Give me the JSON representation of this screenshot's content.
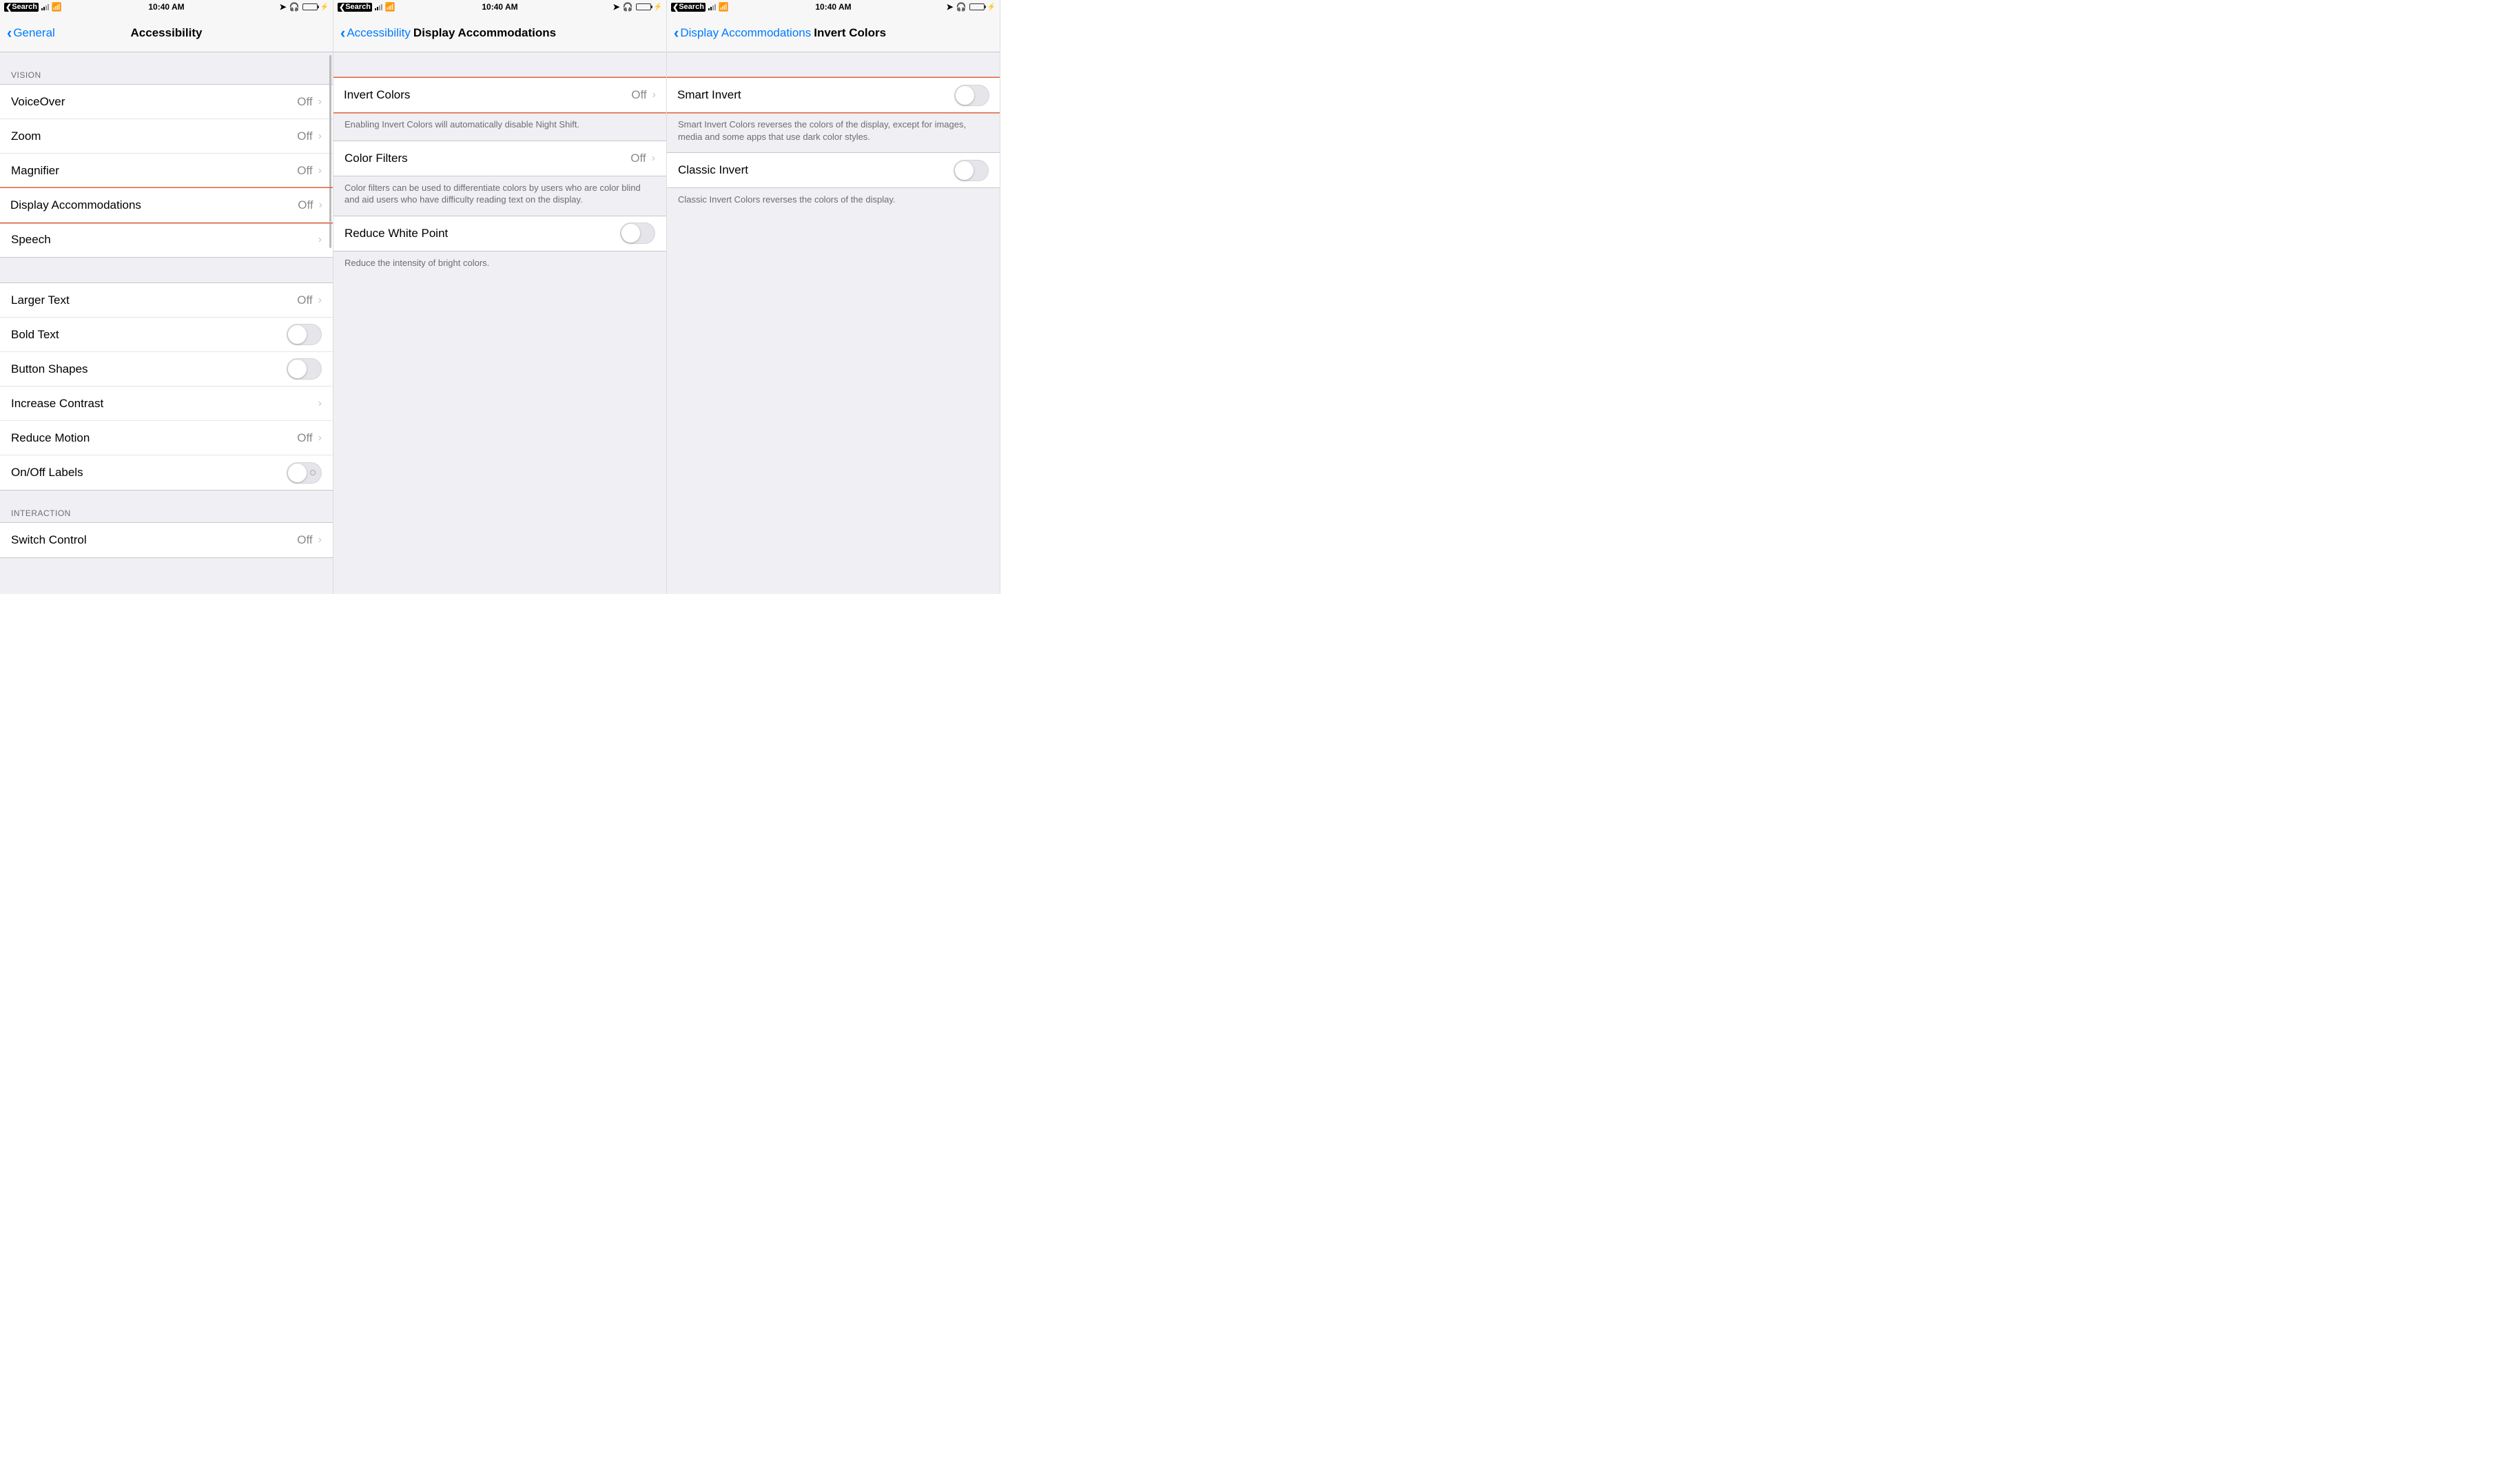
{
  "status": {
    "back_app": "Search",
    "time": "10:40 AM"
  },
  "screen1": {
    "back_label": "General",
    "title": "Accessibility",
    "sections": {
      "vision_header": "VISION",
      "interaction_header": "INTERACTION"
    },
    "cells": {
      "voiceover": {
        "label": "VoiceOver",
        "value": "Off"
      },
      "zoom": {
        "label": "Zoom",
        "value": "Off"
      },
      "magnifier": {
        "label": "Magnifier",
        "value": "Off"
      },
      "display_accom": {
        "label": "Display Accommodations",
        "value": "Off"
      },
      "speech": {
        "label": "Speech"
      },
      "larger_text": {
        "label": "Larger Text",
        "value": "Off"
      },
      "bold_text": {
        "label": "Bold Text"
      },
      "button_shapes": {
        "label": "Button Shapes"
      },
      "increase_contrast": {
        "label": "Increase Contrast"
      },
      "reduce_motion": {
        "label": "Reduce Motion",
        "value": "Off"
      },
      "onoff_labels": {
        "label": "On/Off Labels"
      },
      "switch_control": {
        "label": "Switch Control",
        "value": "Off"
      }
    }
  },
  "screen2": {
    "back_label": "Accessibility",
    "title": "Display Accommodations",
    "cells": {
      "invert_colors": {
        "label": "Invert Colors",
        "value": "Off"
      },
      "color_filters": {
        "label": "Color Filters",
        "value": "Off"
      },
      "reduce_white_point": {
        "label": "Reduce White Point"
      }
    },
    "notes": {
      "invert": "Enabling Invert Colors will automatically disable Night Shift.",
      "filters": "Color filters can be used to differentiate colors by users who are color blind and aid users who have difficulty reading text on the display.",
      "rwp": "Reduce the intensity of bright colors."
    }
  },
  "screen3": {
    "back_label": "Display Accommodations",
    "title": "Invert Colors",
    "cells": {
      "smart_invert": {
        "label": "Smart Invert"
      },
      "classic_invert": {
        "label": "Classic Invert"
      }
    },
    "notes": {
      "smart": "Smart Invert Colors reverses the colors of the display, except for images, media and some apps that use dark color styles.",
      "classic": "Classic Invert Colors reverses the colors of the display."
    }
  }
}
